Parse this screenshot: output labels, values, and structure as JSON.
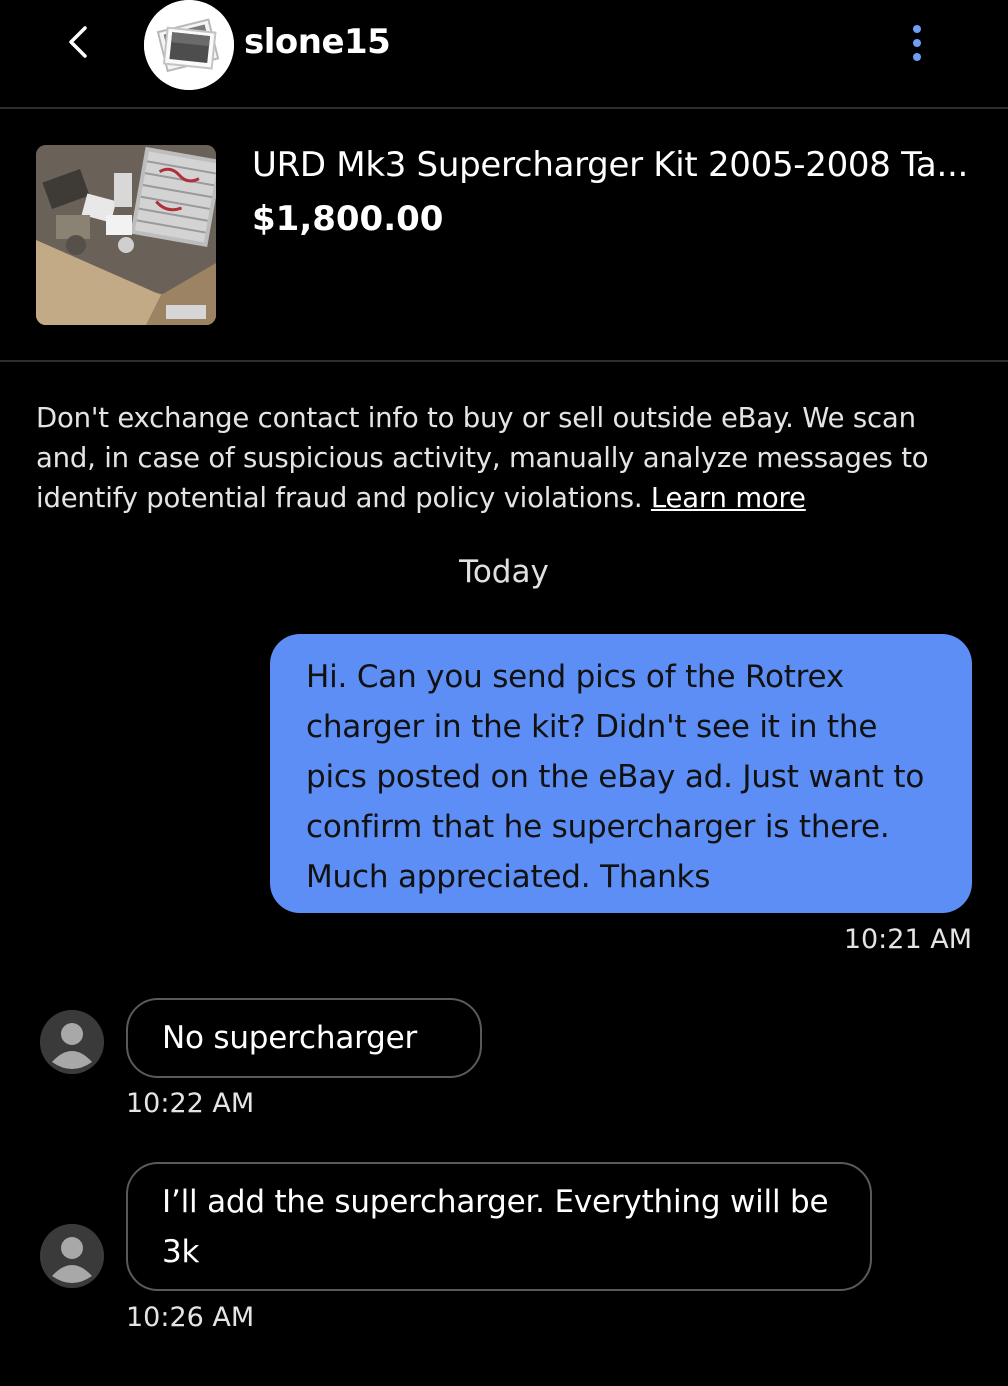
{
  "header": {
    "username": "slone15"
  },
  "item": {
    "title": "URD Mk3 Supercharger Kit 2005-2008 Ta...",
    "price": "$1,800.00"
  },
  "notice": {
    "text": "Don't exchange contact info to buy or sell outside eBay. We scan and, in case of suspicious activity, manually analyze messages to identify potential fraud and policy violations. ",
    "link": "Learn more"
  },
  "conversation": {
    "day": "Today",
    "messages": [
      {
        "direction": "sent",
        "text": "Hi. Can you send pics of the Rotrex charger in the kit?  Didn't see it in the pics posted on the eBay ad.  Just want to confirm that he supercharger is there. Much appreciated. Thanks",
        "time": "10:21 AM"
      },
      {
        "direction": "received",
        "text": "No supercharger",
        "time": "10:22 AM"
      },
      {
        "direction": "received",
        "text": "I’ll add the supercharger. Everything will be 3k",
        "time": "10:26 AM"
      }
    ]
  },
  "colors": {
    "background": "#000000",
    "sent_bubble": "#5c8ef5",
    "menu_dots": "#6e9ff5",
    "divider": "#2e2e2e"
  },
  "icons": {
    "back": "chevron-left-icon",
    "menu": "more-vertical-icon",
    "avatar": "user-icon"
  }
}
